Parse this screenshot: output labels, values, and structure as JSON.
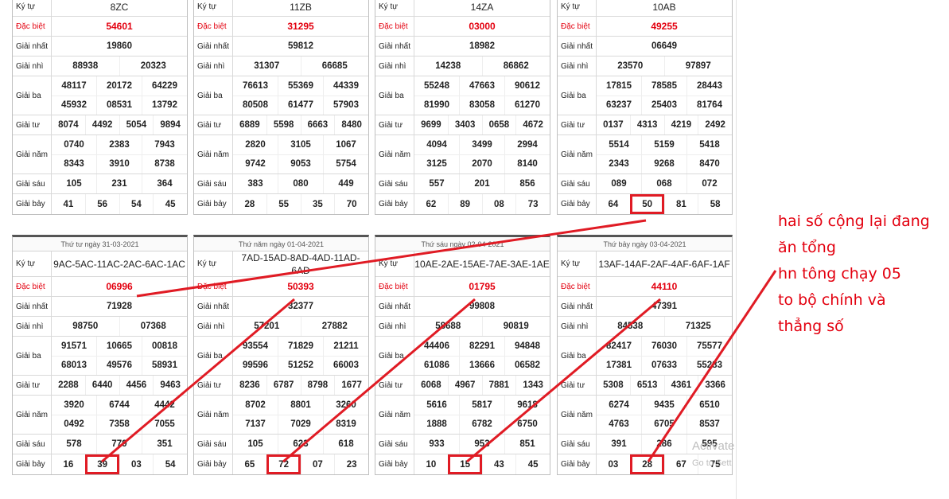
{
  "labels": [
    "Ký tự",
    "Đặc biệt",
    "Giải nhất",
    "Giải nhì",
    "Giải ba",
    "Giải tư",
    "Giải năm",
    "Giải sáu",
    "Giải bảy"
  ],
  "top_tables": [
    {
      "kytu": "8ZC",
      "db": "54601",
      "g1": "19860",
      "g2": [
        "88938",
        "20323"
      ],
      "g3": [
        [
          "48117",
          "20172",
          "64229"
        ],
        [
          "45932",
          "08531",
          "13792"
        ]
      ],
      "g4": [
        "8074",
        "4492",
        "5054",
        "9894"
      ],
      "g5": [
        [
          "0740",
          "2383",
          "7943"
        ],
        [
          "8343",
          "3910",
          "8738"
        ]
      ],
      "g6": [
        "105",
        "231",
        "364"
      ],
      "g7": [
        "41",
        "56",
        "54",
        "45"
      ]
    },
    {
      "kytu": "11ZB",
      "db": "31295",
      "g1": "59812",
      "g2": [
        "31307",
        "66685"
      ],
      "g3": [
        [
          "76613",
          "55369",
          "44339"
        ],
        [
          "80508",
          "61477",
          "57903"
        ]
      ],
      "g4": [
        "6889",
        "5598",
        "6663",
        "8480"
      ],
      "g5": [
        [
          "2820",
          "3105",
          "1067"
        ],
        [
          "9742",
          "9053",
          "5754"
        ]
      ],
      "g6": [
        "383",
        "080",
        "449"
      ],
      "g7": [
        "28",
        "55",
        "35",
        "70"
      ]
    },
    {
      "kytu": "14ZA",
      "db": "03000",
      "g1": "18982",
      "g2": [
        "14238",
        "86862"
      ],
      "g3": [
        [
          "55248",
          "47663",
          "90612"
        ],
        [
          "81990",
          "83058",
          "61270"
        ]
      ],
      "g4": [
        "9699",
        "3403",
        "0658",
        "4672"
      ],
      "g5": [
        [
          "4094",
          "3499",
          "2994"
        ],
        [
          "3125",
          "2070",
          "8140"
        ]
      ],
      "g6": [
        "557",
        "201",
        "856"
      ],
      "g7": [
        "62",
        "89",
        "08",
        "73"
      ]
    },
    {
      "kytu": "10AB",
      "db": "49255",
      "g1": "06649",
      "g2": [
        "23570",
        "97897"
      ],
      "g3": [
        [
          "17815",
          "78585",
          "28443"
        ],
        [
          "63237",
          "25403",
          "81764"
        ]
      ],
      "g4": [
        "0137",
        "4313",
        "4219",
        "2492"
      ],
      "g5": [
        [
          "5514",
          "5159",
          "5418"
        ],
        [
          "2343",
          "9268",
          "8470"
        ]
      ],
      "g6": [
        "089",
        "068",
        "072"
      ],
      "g7": [
        "64",
        "50",
        "81",
        "58"
      ]
    }
  ],
  "bottom_tables": [
    {
      "date": "Thứ tư ngày 31-03-2021",
      "kytu": "9AC-5AC-11AC-2AC-6AC-1AC",
      "db": "06996",
      "g1": "71928",
      "g2": [
        "98750",
        "07368"
      ],
      "g3": [
        [
          "91571",
          "10665",
          "00818"
        ],
        [
          "68013",
          "49576",
          "58931"
        ]
      ],
      "g4": [
        "2288",
        "6440",
        "4456",
        "9463"
      ],
      "g5": [
        [
          "3920",
          "6744",
          "4442"
        ],
        [
          "0492",
          "7358",
          "7055"
        ]
      ],
      "g6": [
        "578",
        "779",
        "351"
      ],
      "g7": [
        "16",
        "39",
        "03",
        "54"
      ]
    },
    {
      "date": "Thứ năm ngày 01-04-2021",
      "kytu": "7AD-15AD-8AD-4AD-11AD-6AD",
      "db": "50393",
      "g1": "32377",
      "g2": [
        "57201",
        "27882"
      ],
      "g3": [
        [
          "93554",
          "71829",
          "21211"
        ],
        [
          "99596",
          "51252",
          "66003"
        ]
      ],
      "g4": [
        "8236",
        "6787",
        "8798",
        "1677"
      ],
      "g5": [
        [
          "8702",
          "8801",
          "3260"
        ],
        [
          "7137",
          "7029",
          "8319"
        ]
      ],
      "g6": [
        "105",
        "623",
        "618"
      ],
      "g7": [
        "65",
        "72",
        "07",
        "23"
      ]
    },
    {
      "date": "Thứ sáu ngày 02-04-2021",
      "kytu": "10AE-2AE-15AE-7AE-3AE-1AE",
      "db": "01795",
      "g1": "99808",
      "g2": [
        "58688",
        "90819"
      ],
      "g3": [
        [
          "44406",
          "82291",
          "94848"
        ],
        [
          "61086",
          "13666",
          "06582"
        ]
      ],
      "g4": [
        "6068",
        "4967",
        "7881",
        "1343"
      ],
      "g5": [
        [
          "5616",
          "5817",
          "9618"
        ],
        [
          "1888",
          "6782",
          "6750"
        ]
      ],
      "g6": [
        "933",
        "953",
        "851"
      ],
      "g7": [
        "10",
        "15",
        "43",
        "45"
      ]
    },
    {
      "date": "Thứ bảy ngày 03-04-2021",
      "kytu": "13AF-14AF-2AF-4AF-6AF-1AF",
      "db": "44110",
      "g1": "47391",
      "g2": [
        "84538",
        "71325"
      ],
      "g3": [
        [
          "82417",
          "76030",
          "75577"
        ],
        [
          "17381",
          "07633",
          "55283"
        ]
      ],
      "g4": [
        "5308",
        "6513",
        "4361",
        "3366"
      ],
      "g5": [
        [
          "6274",
          "9435",
          "6510"
        ],
        [
          "4763",
          "6705",
          "8537"
        ]
      ],
      "g6": [
        "391",
        "286",
        "595"
      ],
      "g7": [
        "03",
        "28",
        "67",
        "75"
      ]
    }
  ],
  "annotation": [
    "hai số cộng lại đang",
    "ăn tổng",
    "hn tông chạy 05",
    "to bộ chính và",
    "thẳng số"
  ],
  "watermark": [
    "Activate",
    "Go to Sett"
  ],
  "colors": {
    "accent_red": "#e3000f",
    "marker_red": "#e01b24"
  }
}
